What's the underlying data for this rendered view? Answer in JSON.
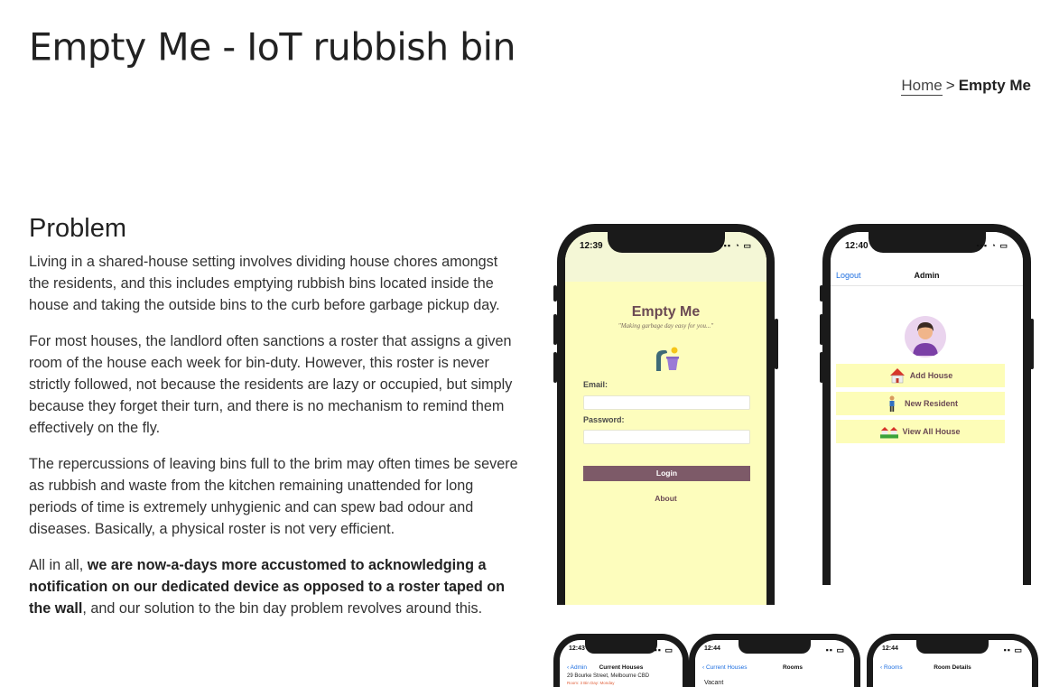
{
  "page": {
    "title": "Empty Me - IoT rubbish bin"
  },
  "breadcrumb": {
    "home": "Home",
    "separator": ">",
    "current": "Empty Me"
  },
  "section": {
    "heading": "Problem",
    "p1": "Living in a shared-house setting involves dividing house chores amongst the residents, and this includes emptying rubbish bins located inside the house and taking the outside bins to the curb before garbage pickup day.",
    "p2": "For most houses, the landlord often sanctions a roster that assigns a given room of the house each week for bin-duty. However, this roster is never strictly followed, not because the residents are lazy or occupied, but simply because they forget their turn, and there is no mechanism to remind them effectively on the fly.",
    "p3": "The repercussions of leaving bins full to the brim may often times be severe as rubbish and waste from the kitchen remaining unattended for long periods of time is extremely unhygienic and can spew bad odour and diseases. Basically, a physical roster is not very efficient.",
    "p4_start": "All in all, ",
    "p4_bold": "we are now-a-days more accustomed to acknowledging a notification on our dedicated device as opposed to a roster taped on the wall",
    "p4_end": ", and our solution to the bin day problem revolves around this."
  },
  "screenshots": {
    "login": {
      "time": "12:39",
      "app_name": "Empty Me",
      "tagline": "\"Making garbage day easy for you...\"",
      "email_label": "Email:",
      "password_label": "Password:",
      "login_button": "Login",
      "about_link": "About",
      "background_color": "#fdfdbd",
      "button_color": "#7d5a68"
    },
    "admin": {
      "time": "12:40",
      "nav_left": "Logout",
      "nav_title": "Admin",
      "menu": [
        "Add House",
        "New Resident",
        "View All House"
      ],
      "link_color": "#1f6fe0"
    },
    "houses": {
      "time": "12:43",
      "nav_left": "Admin",
      "nav_title": "Current Houses",
      "row": "29 Bourke Street, Melbourne CBD",
      "row_sub": "Room: 3 Bin Day: Monday"
    },
    "rooms": {
      "time": "12:44",
      "nav_left": "Current Houses",
      "nav_title": "Rooms",
      "row": "Vacant"
    },
    "room_details": {
      "time": "12:44",
      "nav_left": "Rooms",
      "nav_title": "Room Details"
    }
  }
}
